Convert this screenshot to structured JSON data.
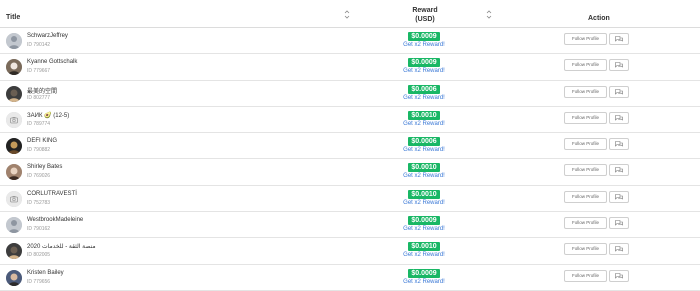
{
  "header": {
    "title": "Title",
    "reward_line1": "Reward",
    "reward_line2": "(USD)",
    "action": "Action"
  },
  "rows": [
    {
      "name": "SchwarzJeffrey",
      "id": "ID 790142",
      "reward": "$0.0009",
      "getx2": "Get x2 Reward!",
      "follow": "Follow Profile",
      "avatar": "default-avatar"
    },
    {
      "name": "Kyanne Gottschalk",
      "id": "ID 779667",
      "reward": "$0.0009",
      "getx2": "Get x2 Reward!",
      "follow": "Follow Profile",
      "avatar": "photo-avatar"
    },
    {
      "name": "最美的空間",
      "id": "ID 802777",
      "reward": "$0.0006",
      "getx2": "Get x2 Reward!",
      "follow": "Follow Profile",
      "avatar": "photo-avatar"
    },
    {
      "name": "ЗАИК 🥑 (12-5)",
      "id": "ID 789774",
      "reward": "$0.0010",
      "getx2": "Get x2 Reward!",
      "follow": "Follow Profile",
      "avatar": "camera-avatar"
    },
    {
      "name": "DEFI KING",
      "id": "ID 790882",
      "reward": "$0.0006",
      "getx2": "Get x2 Reward!",
      "follow": "Follow Profile",
      "avatar": "photo-avatar"
    },
    {
      "name": "Shirley Bates",
      "id": "ID 769026",
      "reward": "$0.0010",
      "getx2": "Get x2 Reward!",
      "follow": "Follow Profile",
      "avatar": "photo-avatar"
    },
    {
      "name": "CORLUTRAVESTİ",
      "id": "ID 752783",
      "reward": "$0.0010",
      "getx2": "Get x2 Reward!",
      "follow": "Follow Profile",
      "avatar": "camera-avatar"
    },
    {
      "name": "WestbrookMadeleine",
      "id": "ID 790162",
      "reward": "$0.0009",
      "getx2": "Get x2 Reward!",
      "follow": "Follow Profile",
      "avatar": "default-avatar"
    },
    {
      "name": "منصة الثقة - للخدمات 2020",
      "id": "ID 802005",
      "reward": "$0.0010",
      "getx2": "Get x2 Reward!",
      "follow": "Follow Profile",
      "avatar": "photo-avatar"
    },
    {
      "name": "Kristen Bailey",
      "id": "ID 779656",
      "reward": "$0.0009",
      "getx2": "Get x2 Reward!",
      "follow": "Follow Profile",
      "avatar": "photo-avatar"
    }
  ],
  "colors": {
    "reward_badge": "#19b765",
    "link": "#3a78d6"
  }
}
